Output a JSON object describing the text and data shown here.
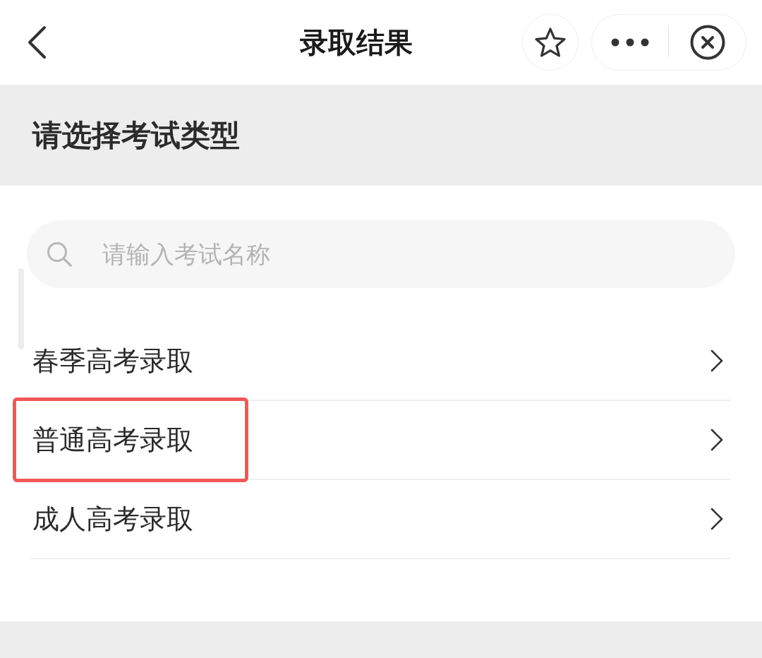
{
  "nav_bar": {
    "title": "录取结果"
  },
  "section": {
    "heading": "请选择考试类型"
  },
  "search": {
    "placeholder": "请输入考试名称"
  },
  "items": [
    {
      "label": "春季高考录取",
      "highlighted": false
    },
    {
      "label": "普通高考录取",
      "highlighted": true
    },
    {
      "label": "成人高考录取",
      "highlighted": false
    }
  ]
}
